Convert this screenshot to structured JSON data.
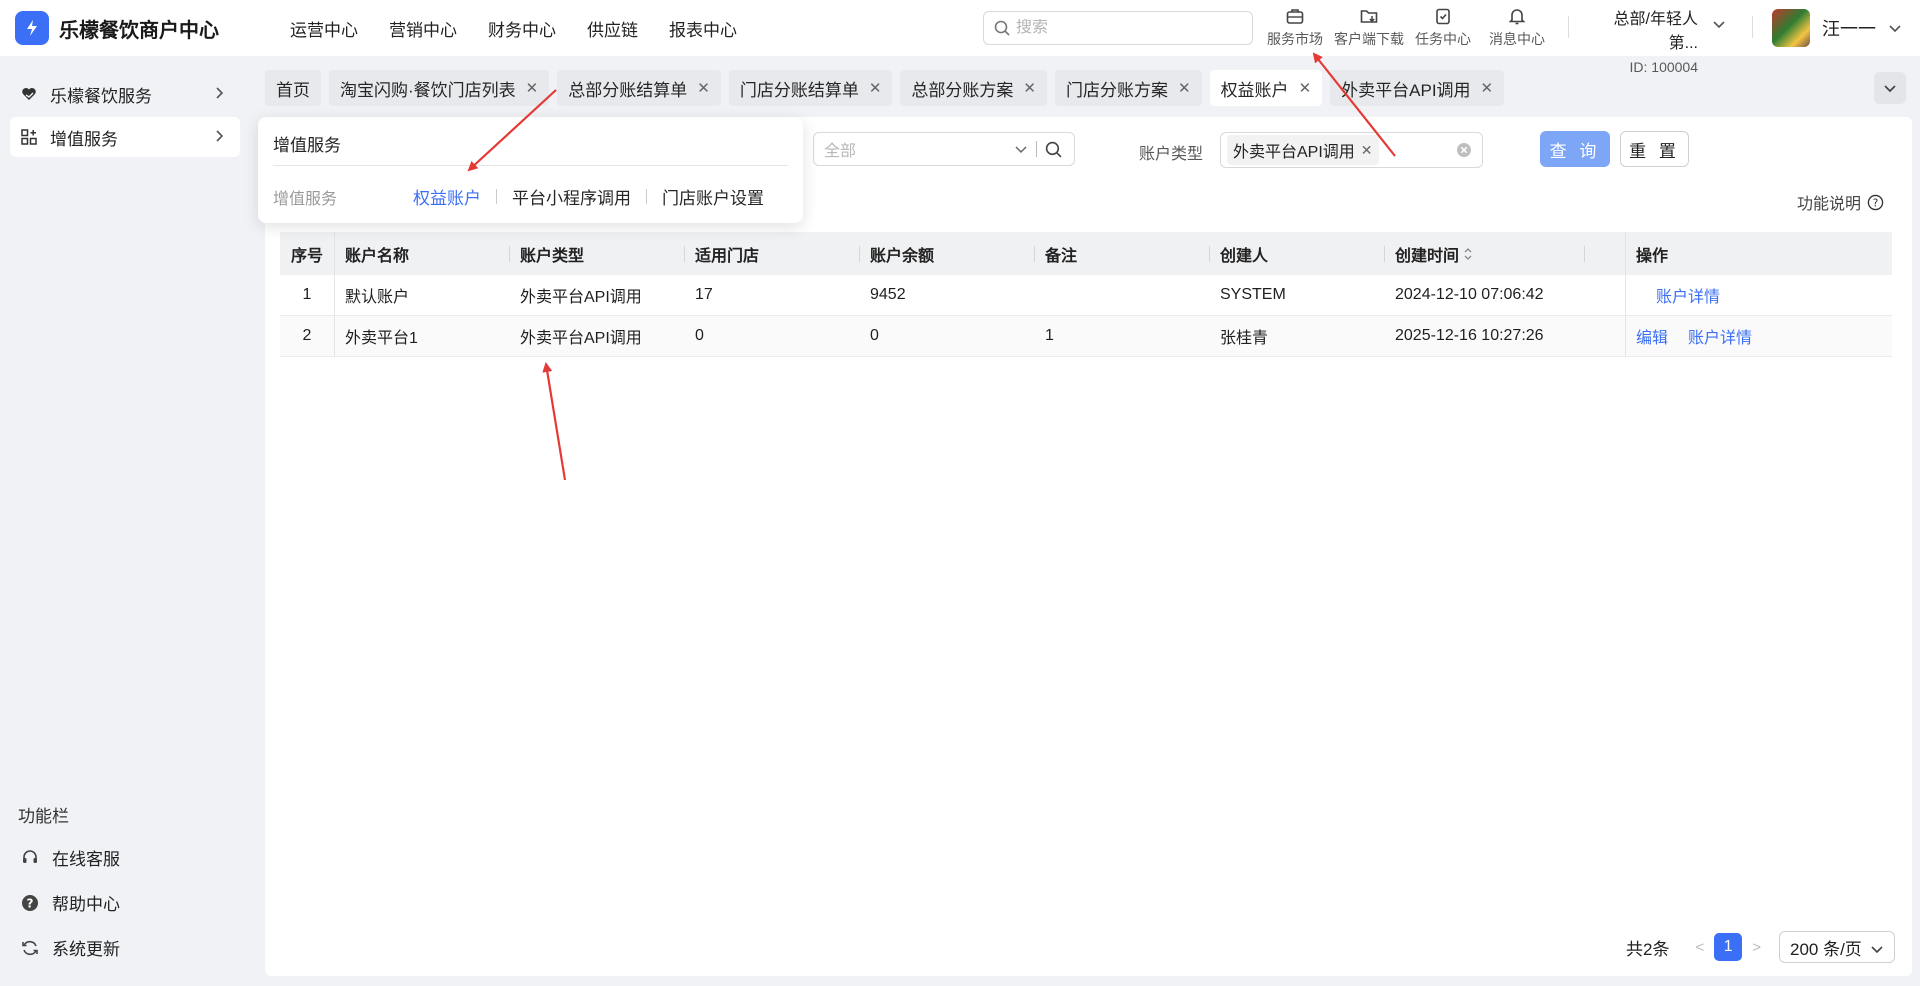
{
  "app": {
    "title": "乐檬餐饮商户中心",
    "brand_color": "#3b6ff5"
  },
  "topnav": [
    "运营中心",
    "营销中心",
    "财务中心",
    "供应链",
    "报表中心"
  ],
  "search": {
    "placeholder": "搜索"
  },
  "header_icons": [
    {
      "label": "服务市场",
      "icon": "briefcase-icon"
    },
    {
      "label": "客户端下载",
      "icon": "folder-download-icon"
    },
    {
      "label": "任务中心",
      "icon": "clipboard-icon"
    },
    {
      "label": "消息中心",
      "icon": "bell-icon"
    }
  ],
  "org": {
    "name": "总部/年轻人第...",
    "id": "ID: 100004"
  },
  "user": {
    "name": "汪一一"
  },
  "sidebar": {
    "items": [
      {
        "label": "乐檬餐饮服务",
        "icon": "heart-hand-icon"
      },
      {
        "label": "增值服务",
        "icon": "grid-plus-icon"
      }
    ],
    "section_title": "功能栏",
    "footer": [
      {
        "label": "在线客服",
        "icon": "headset-icon"
      },
      {
        "label": "帮助中心",
        "icon": "help-circle-icon"
      },
      {
        "label": "系统更新",
        "icon": "refresh-icon"
      }
    ]
  },
  "tabs": [
    {
      "label": "首页",
      "closable": false
    },
    {
      "label": "淘宝闪购·餐饮门店列表",
      "closable": true
    },
    {
      "label": "总部分账结算单",
      "closable": true
    },
    {
      "label": "门店分账结算单",
      "closable": true
    },
    {
      "label": "总部分账方案",
      "closable": true
    },
    {
      "label": "门店分账方案",
      "closable": true
    },
    {
      "label": "权益账户",
      "closable": true,
      "active": true
    },
    {
      "label": "外卖平台API调用",
      "closable": true
    }
  ],
  "dropdown": {
    "title": "增值服务",
    "category": "增值服务",
    "links": [
      "权益账户",
      "平台小程序调用",
      "门店账户设置"
    ],
    "selected": "权益账户"
  },
  "filters": {
    "store_placeholder": "全部",
    "account_type_label": "账户类型",
    "account_type_tag": "外卖平台API调用",
    "query_button": "查 询",
    "reset_button": "重 置",
    "help_link": "功能说明"
  },
  "table": {
    "headers": [
      "序号",
      "账户名称",
      "账户类型",
      "适用门店",
      "账户余额",
      "备注",
      "创建人",
      "创建时间",
      "",
      "操作"
    ],
    "rows": [
      {
        "no": "1",
        "name": "默认账户",
        "type": "外卖平台API调用",
        "stores": "17",
        "balance": "9452",
        "remark": "",
        "creator": "SYSTEM",
        "created": "2024-12-10 07:06:42",
        "actions": [
          "账户详情"
        ]
      },
      {
        "no": "2",
        "name": "外卖平台1",
        "type": "外卖平台API调用",
        "stores": "0",
        "balance": "0",
        "remark": "1",
        "creator": "张桂青",
        "created": "2025-12-16 10:27:26",
        "actions": [
          "编辑",
          "账户详情"
        ]
      }
    ]
  },
  "pagination": {
    "total": "共2条",
    "current_page": "1",
    "page_size": "200 条/页"
  },
  "annotation_color": "#e53935"
}
